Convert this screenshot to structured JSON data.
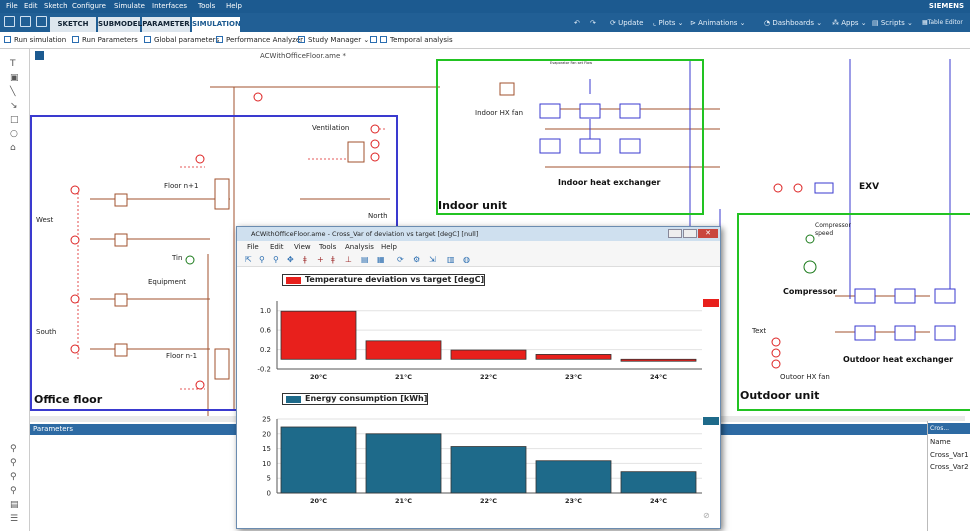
{
  "menubar": {
    "items": [
      "File",
      "Edit",
      "Sketch",
      "Configure",
      "Simulate",
      "Interfaces",
      "Tools",
      "Help"
    ],
    "brand": "SIEMENS"
  },
  "tabs": [
    {
      "label": "SKETCH",
      "active": false
    },
    {
      "label": "SUBMODEL",
      "active": false
    },
    {
      "label": "PARAMETER",
      "active": false
    },
    {
      "label": "SIMULATION",
      "active": true
    }
  ],
  "right_toolbar": {
    "update": "Update",
    "plots": "Plots",
    "animations": "Animations",
    "dashboards": "Dashboards",
    "apps": "Apps",
    "scripts": "Scripts",
    "table_editor": "Table Editor"
  },
  "toolbar": {
    "run_simulation": "Run simulation",
    "run_parameters": "Run Parameters",
    "global_parameters": "Global parameters",
    "performance_analyzer": "Performance Analyzer",
    "study_manager": "Study Manager",
    "temporal_analysis": "Temporal analysis"
  },
  "canvas": {
    "file_title": "ACWithOfficeFloor.ame *",
    "labels": {
      "ventilation": "Ventilation",
      "floor_n1": "Floor n+1",
      "west": "West",
      "north": "North",
      "tin": "Tin",
      "equipment": "Equipment",
      "south": "South",
      "floor_nm1": "Floor n-1",
      "indoor_hx_fan": "Indoor HX fan",
      "indoor_heat_exchanger": "Indoor heat exchanger",
      "exv": "EXV",
      "compressor_speed": "Compressor speed",
      "compressor": "Compressor",
      "text": "Text",
      "outdoor_hx_fan": "Outoor HX fan",
      "outdoor_heat_exchanger": "Outdoor heat exchanger",
      "evap_tiny": "Evaporator Fan set Flow"
    },
    "boxes": {
      "office_floor": "Office floor",
      "indoor_unit": "Indoor unit",
      "outdoor_unit": "Outdoor unit"
    },
    "colors": {
      "office": "#3a3acf",
      "indoor": "#22c322",
      "outdoor": "#22c322",
      "pipe": "#a0522d",
      "signal": "#dd2222"
    }
  },
  "parameters_panel": {
    "title": "Parameters"
  },
  "cross_panel": {
    "title": "Cros...",
    "header": "Name",
    "rows": [
      "Cross_Var1",
      "Cross_Var2"
    ]
  },
  "plot_window": {
    "title": "ACWithOfficeFloor.ame - Cross_Var of deviation vs target [degC] [null]",
    "menu": [
      "File",
      "Edit",
      "View",
      "Tools",
      "Analysis",
      "Help"
    ]
  },
  "chart_data": [
    {
      "type": "bar",
      "title": "Temperature deviation vs target [degC]",
      "categories": [
        "20°C",
        "21°C",
        "22°C",
        "23°C",
        "24°C"
      ],
      "series": [
        {
          "name": "Temperature deviation vs target [degC]",
          "values": [
            0.99,
            0.38,
            0.19,
            0.1,
            -0.04
          ]
        }
      ],
      "ylim": [
        -0.2,
        1.2
      ],
      "yticks": [
        "1.0",
        "0.6",
        "0.2",
        "-0.2"
      ],
      "color": "#e8201c",
      "grid": true
    },
    {
      "type": "bar",
      "title": "Energy consumption [kWh]",
      "categories": [
        "20°C",
        "21°C",
        "22°C",
        "23°C",
        "24°C"
      ],
      "series": [
        {
          "name": "Energy consumption [kWh]",
          "values": [
            22.3,
            20.0,
            15.7,
            10.9,
            7.2
          ]
        }
      ],
      "ylim": [
        0,
        25
      ],
      "yticks": [
        "25",
        "20",
        "15",
        "10",
        "5",
        "0"
      ],
      "color": "#1e6a8a",
      "grid": true
    }
  ]
}
